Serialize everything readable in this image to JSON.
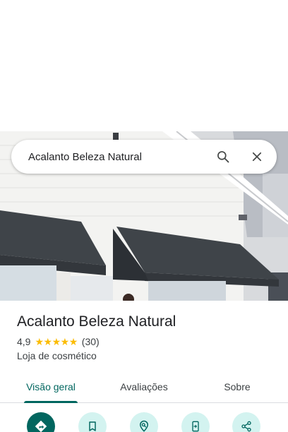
{
  "search": {
    "query": "Acalanto Beleza Natural",
    "search_icon": "search-icon",
    "close_icon": "close-icon"
  },
  "place": {
    "name": "Acalanto Beleza Natural",
    "rating": "4,9",
    "stars": 5,
    "review_count": "(30)",
    "category": "Loja de cosmético"
  },
  "tabs": [
    {
      "label": "Visão geral",
      "selected": true
    },
    {
      "label": "Avaliações",
      "selected": false
    },
    {
      "label": "Sobre",
      "selected": false
    }
  ],
  "actions": [
    {
      "icon": "directions-icon"
    },
    {
      "icon": "bookmark-icon"
    },
    {
      "icon": "nearby-icon"
    },
    {
      "icon": "send-to-phone-icon"
    },
    {
      "icon": "share-icon"
    }
  ],
  "colors": {
    "accent": "#01665f",
    "accent_light": "#d3f3f0",
    "star": "#fbbc04"
  }
}
